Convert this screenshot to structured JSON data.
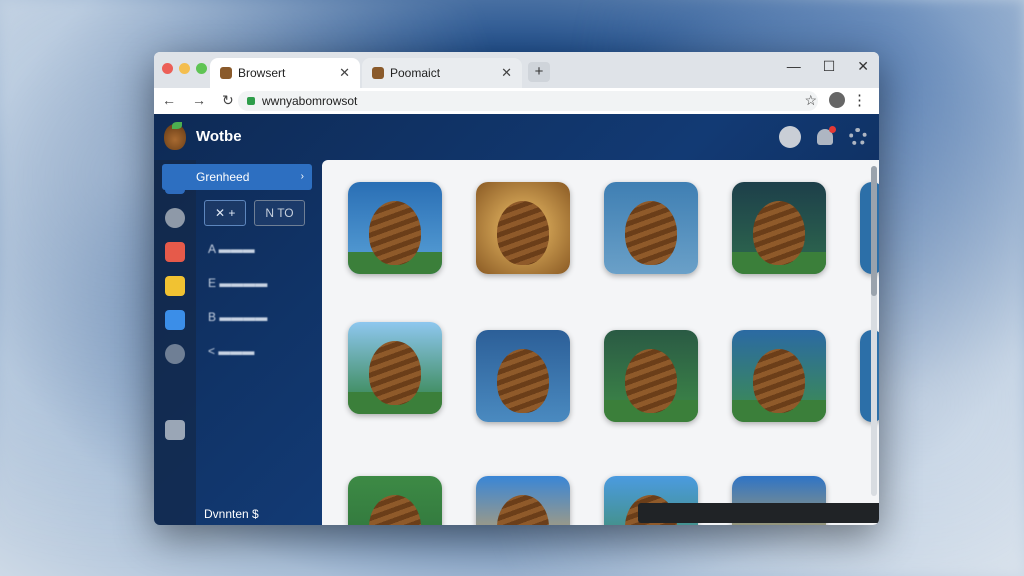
{
  "browser": {
    "tabs": [
      {
        "label": "Browsert",
        "close": "✕"
      },
      {
        "label": "Poomaict",
        "close": "✕"
      }
    ],
    "new_tab": "+",
    "window_controls": [
      "—",
      "☐",
      "✕"
    ],
    "nav": [
      "←",
      "→",
      "↻"
    ],
    "url": "wwnyabomrowsot",
    "star": "☆",
    "menu": "⋮"
  },
  "app": {
    "title": "Wotbe",
    "sidebar": {
      "selected": "Grenheed",
      "selected_chevron": "›",
      "buttons": [
        "✕ +",
        "Ν ΤΟ"
      ],
      "items": [
        "A ▬▬▬",
        "E ▬▬▬▬",
        "B ▬▬▬▬",
        "< ▬▬▬"
      ]
    },
    "status_text": "Dvnnten $",
    "rail_icons": [
      "pen-icon",
      "gear-icon",
      "puzzle-icon",
      "calendar-icon",
      "shield-icon",
      "network-icon",
      "settings-small-icon"
    ],
    "tiles_count_per_row": 5
  },
  "colors": {
    "accent": "#2d6fc1",
    "header_bg": "#0e2a55",
    "dot_red": "#ec5f57",
    "dot_yellow": "#f4be4f",
    "dot_green": "#5fc454"
  }
}
